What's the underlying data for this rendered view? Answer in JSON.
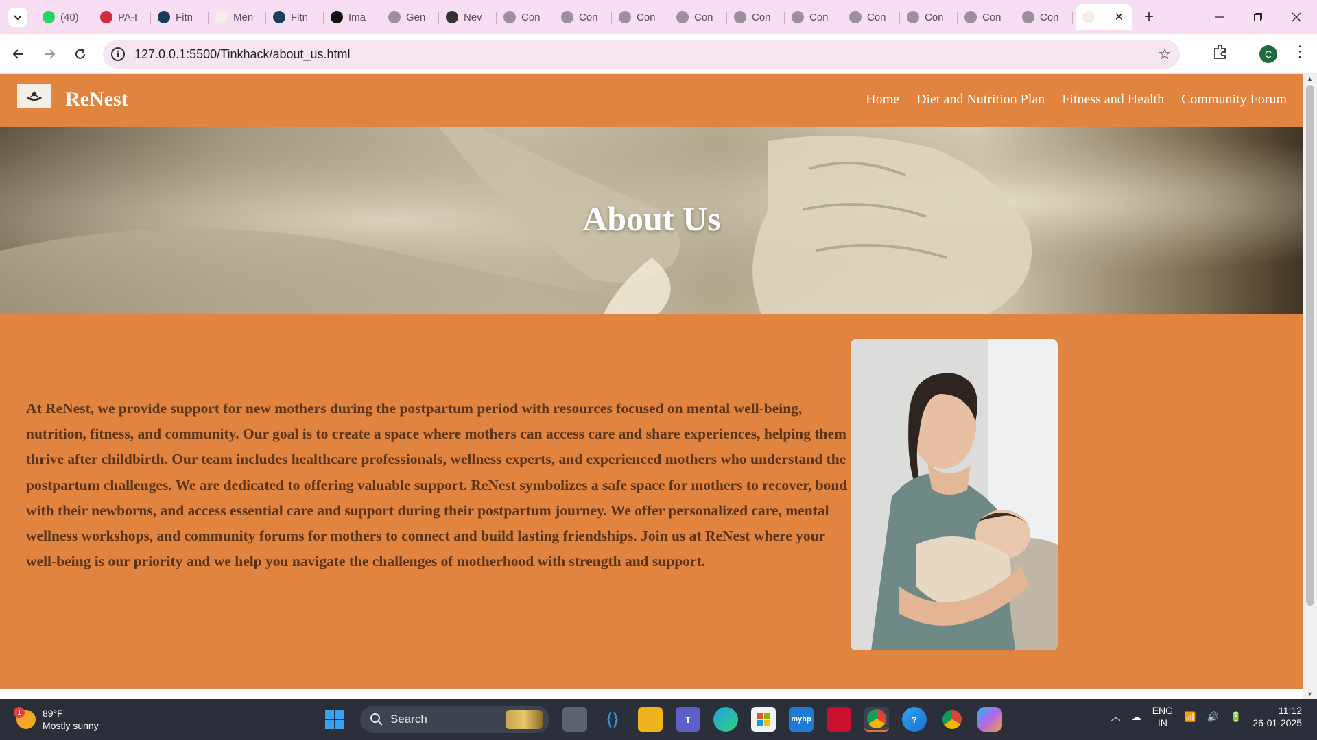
{
  "browser": {
    "tabs": [
      {
        "title": "(40)",
        "icon": "whatsapp-icon",
        "color": "#25d366"
      },
      {
        "title": "PA-I",
        "icon": "gift-icon",
        "color": "#d12d3c"
      },
      {
        "title": "Fitn",
        "icon": "image-icon",
        "color": "#1a3d5c"
      },
      {
        "title": "Men",
        "icon": "renest-logo-icon",
        "color": "#f3eee6"
      },
      {
        "title": "Fitn",
        "icon": "image-icon",
        "color": "#1a3d5c"
      },
      {
        "title": "Ima",
        "icon": "openai-icon",
        "color": "#111111"
      },
      {
        "title": "Gen",
        "icon": "github-icon",
        "color": "#9e8f9c"
      },
      {
        "title": "Nev",
        "icon": "chatgpt-icon",
        "color": "#333333"
      },
      {
        "title": "Con",
        "icon": "globe-icon",
        "color": "#9e8f9c"
      },
      {
        "title": "Con",
        "icon": "globe-icon",
        "color": "#9e8f9c"
      },
      {
        "title": "Con",
        "icon": "globe-icon",
        "color": "#9e8f9c"
      },
      {
        "title": "Con",
        "icon": "globe-icon",
        "color": "#9e8f9c"
      },
      {
        "title": "Con",
        "icon": "globe-icon",
        "color": "#9e8f9c"
      },
      {
        "title": "Con",
        "icon": "globe-icon",
        "color": "#9e8f9c"
      },
      {
        "title": "Con",
        "icon": "globe-icon",
        "color": "#9e8f9c"
      },
      {
        "title": "Con",
        "icon": "globe-icon",
        "color": "#9e8f9c"
      },
      {
        "title": "Con",
        "icon": "globe-icon",
        "color": "#9e8f9c"
      },
      {
        "title": "Con",
        "icon": "globe-icon",
        "color": "#9e8f9c"
      }
    ],
    "active_tab_icon": "renest-logo-icon",
    "url": "127.0.0.1:5500/Tinkhack/about_us.html",
    "profile_initial": "C"
  },
  "site": {
    "brand": "ReNest",
    "nav": [
      "Home",
      "Diet and Nutrition Plan",
      "Fitness and Health",
      "Community Forum"
    ],
    "hero_title": "About Us",
    "about_text": "At ReNest, we provide support for new mothers during the postpartum period with resources focused on mental well-being, nutrition, fitness, and community. Our goal is to create a space where mothers can access care and share experiences, helping them thrive after childbirth. Our team includes healthcare professionals, wellness experts, and experienced mothers who understand the postpartum challenges. We are dedicated to offering valuable support. ReNest symbolizes a safe space for mothers to recover, bond with their newborns, and access essential care and support during their postpartum journey. We offer personalized care, mental wellness workshops, and community forums for mothers to connect and build lasting friendships. Join us at ReNest where your well-being is our priority and we help you navigate the challenges of motherhood with strength and support.",
    "colors": {
      "header": "#e08440",
      "text": "#5a3418"
    }
  },
  "taskbar": {
    "weather_temp": "89°F",
    "weather_desc": "Mostly sunny",
    "weather_badge": "1",
    "search_placeholder": "Search",
    "lang_line1": "ENG",
    "lang_line2": "IN",
    "time": "11:12",
    "date": "26-01-2025"
  }
}
